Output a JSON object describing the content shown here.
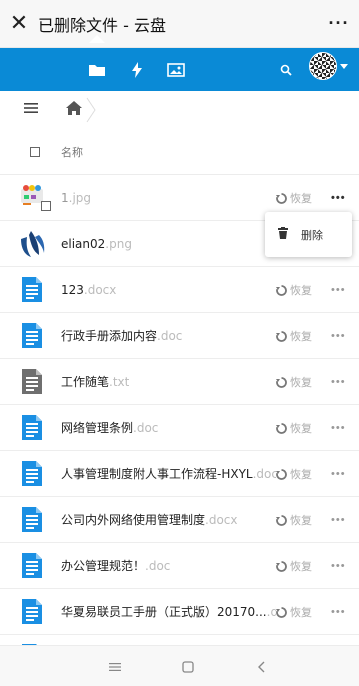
{
  "titlebar": {
    "close_glyph": "✕",
    "title": "已删除文件 - 云盘",
    "more_glyph": "···"
  },
  "navbar": {
    "background": "#0a8ad6",
    "icons": [
      "folder-icon",
      "lightning-icon",
      "image-icon",
      "search-icon"
    ]
  },
  "header": {
    "column_name": "名称"
  },
  "popup": {
    "delete_label": "删除"
  },
  "files": [
    {
      "name": "1",
      "ext": ".jpg",
      "type": "image",
      "restore": "恢复",
      "dots": "•••"
    },
    {
      "name": "elian02",
      "ext": ".png",
      "type": "logo",
      "restore": "",
      "dots": ""
    },
    {
      "name": "123",
      "ext": ".docx",
      "type": "doc",
      "restore": "恢复",
      "dots": "•••"
    },
    {
      "name": "行政手册添加内容",
      "ext": ".doc",
      "type": "doc",
      "restore": "恢复",
      "dots": "•••"
    },
    {
      "name": "工作随笔",
      "ext": ".txt",
      "type": "txt",
      "restore": "恢复",
      "dots": "•••"
    },
    {
      "name": "网络管理条例",
      "ext": ".doc",
      "type": "doc",
      "restore": "恢复",
      "dots": "•••"
    },
    {
      "name": "人事管理制度附人事工作流程-HXYL",
      "ext": ".doc",
      "type": "doc",
      "restore": "恢复",
      "dots": "•••"
    },
    {
      "name": "公司内外网络使用管理制度",
      "ext": ".docx",
      "type": "doc",
      "restore": "恢复",
      "dots": "•••"
    },
    {
      "name": "办公管理规范！",
      "ext": ".doc",
      "type": "doc",
      "restore": "恢复",
      "dots": "•••"
    },
    {
      "name": "华夏易联员工手册（正式版）20170...",
      "ext": ".docx",
      "type": "doc",
      "restore": "恢复",
      "dots": "•••"
    }
  ],
  "colors": {
    "accent": "#0a8ad6",
    "doc_icon": "#1a8fe3",
    "txt_icon": "#6f6f6f"
  }
}
